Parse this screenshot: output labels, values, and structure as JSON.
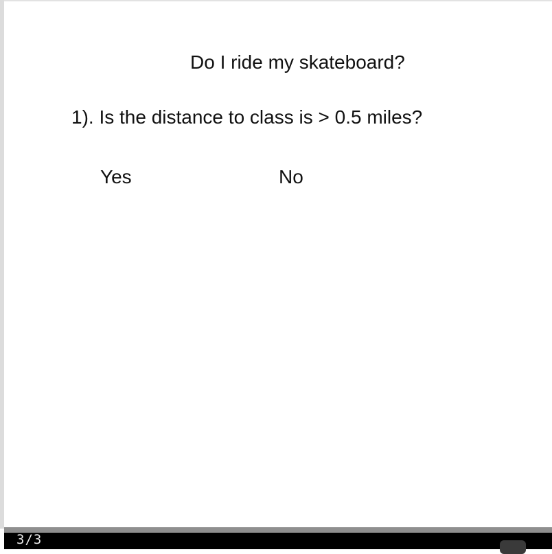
{
  "slide": {
    "title": "Do I ride my skateboard?",
    "question": "1). Is the distance to class is > 0.5 miles?",
    "answers": [
      {
        "label": "Yes"
      },
      {
        "label": "No"
      }
    ]
  },
  "footer": {
    "page_counter": "3/3"
  },
  "colors": {
    "text": "#111111",
    "progress_track": "#8f8f8f",
    "bottom_bar": "#000000"
  }
}
